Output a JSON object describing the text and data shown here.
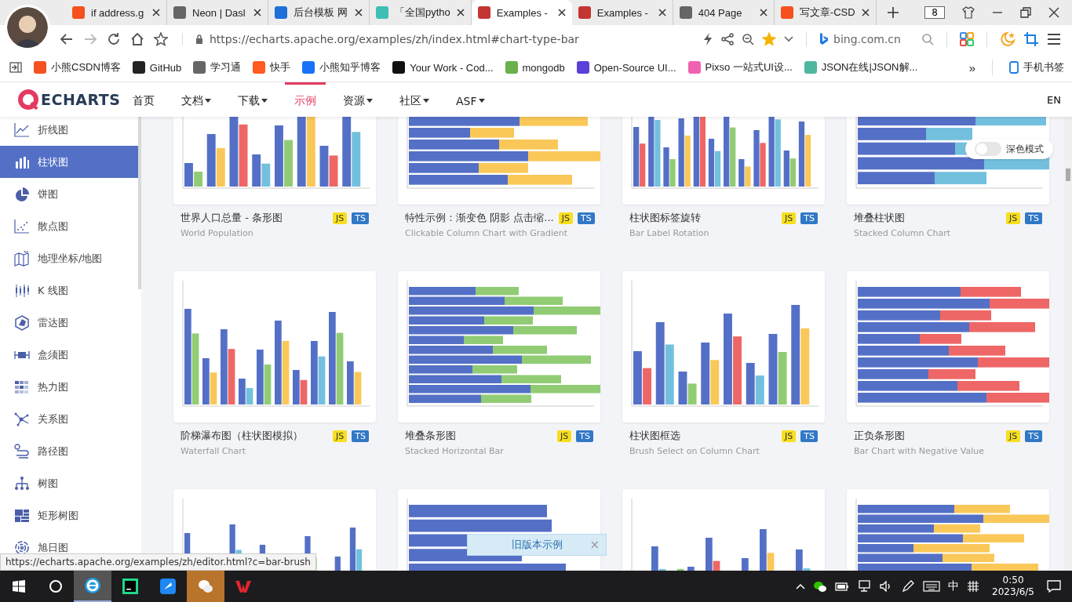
{
  "browser": {
    "tabs": [
      {
        "title": "if address.g",
        "color": "#f4511e",
        "selected": false
      },
      {
        "title": "Neon | Dasl",
        "color": "#666666",
        "selected": false
      },
      {
        "title": "后台模板 网",
        "color": "#1e6fd9",
        "selected": false
      },
      {
        "title": "「全国pytho",
        "color": "#3fbfb4",
        "selected": false
      },
      {
        "title": "Examples -",
        "color": "#c23531",
        "selected": true
      },
      {
        "title": "Examples -",
        "color": "#c23531",
        "selected": false
      },
      {
        "title": "404 Page",
        "color": "#666666",
        "selected": false
      },
      {
        "title": "写文章-CSD",
        "color": "#f4511e",
        "selected": false
      }
    ],
    "tab_count": "8",
    "address": "https://echarts.apache.org/examples/zh/index.html#chart-type-bar",
    "bookmarked": true,
    "search_engine": "bing.com.cn",
    "bookmarks": [
      {
        "label": "小熊CSDN博客",
        "color": "#f4511e"
      },
      {
        "label": "GitHub",
        "color": "#222222"
      },
      {
        "label": "学习通",
        "color": "#666666"
      },
      {
        "label": "快手",
        "color": "#ff5a1f"
      },
      {
        "label": "小熊知乎博客",
        "color": "#1772f6"
      },
      {
        "label": "Your Work - Cod...",
        "color": "#111111"
      },
      {
        "label": "mongodb",
        "color": "#6ab04c"
      },
      {
        "label": "Open-Source UI...",
        "color": "#5b3fd9"
      },
      {
        "label": "Pixso 一站式UI设...",
        "color": "#f062b0"
      },
      {
        "label": "JSON在线|JSON解...",
        "color": "#4fb7a0"
      }
    ],
    "more": "»",
    "mobile_bookmarks": "手机书签"
  },
  "site": {
    "logo": "ECHARTS",
    "nav": [
      {
        "label": "首页",
        "dropdown": false,
        "selected": false
      },
      {
        "label": "文档",
        "dropdown": true,
        "selected": false
      },
      {
        "label": "下载",
        "dropdown": true,
        "selected": false
      },
      {
        "label": "示例",
        "dropdown": false,
        "selected": true
      },
      {
        "label": "资源",
        "dropdown": true,
        "selected": false
      },
      {
        "label": "社区",
        "dropdown": true,
        "selected": false
      },
      {
        "label": "ASF",
        "dropdown": true,
        "selected": false
      }
    ],
    "language": "EN"
  },
  "sidebar": {
    "items": [
      {
        "label": "折线图",
        "kind": "line",
        "selected": false
      },
      {
        "label": "柱状图",
        "kind": "bar",
        "selected": true
      },
      {
        "label": "饼图",
        "kind": "pie",
        "selected": false
      },
      {
        "label": "散点图",
        "kind": "scatter",
        "selected": false
      },
      {
        "label": "地理坐标/地图",
        "kind": "map",
        "selected": false
      },
      {
        "label": "K 线图",
        "kind": "candlestick",
        "selected": false
      },
      {
        "label": "雷达图",
        "kind": "radar",
        "selected": false
      },
      {
        "label": "盒须图",
        "kind": "boxplot",
        "selected": false
      },
      {
        "label": "热力图",
        "kind": "heatmap",
        "selected": false
      },
      {
        "label": "关系图",
        "kind": "graph",
        "selected": false
      },
      {
        "label": "路径图",
        "kind": "lines",
        "selected": false
      },
      {
        "label": "树图",
        "kind": "tree",
        "selected": false
      },
      {
        "label": "矩形树图",
        "kind": "treemap",
        "selected": false
      },
      {
        "label": "旭日图",
        "kind": "sunburst",
        "selected": false
      }
    ]
  },
  "gallery": {
    "cards": [
      {
        "kind": "example",
        "title": "世界人口总量 - 条形图",
        "subtitle": "World Population",
        "badges": [
          "JS",
          "TS"
        ]
      },
      {
        "kind": "example",
        "title": "特性示例：渐变色 阴影 点击缩...",
        "subtitle": "Clickable Column Chart with Gradient",
        "badges": [
          "JS",
          "TS"
        ]
      },
      {
        "kind": "example",
        "title": "柱状图标签旋转",
        "subtitle": "Bar Label Rotation",
        "badges": [
          "JS",
          "TS"
        ]
      },
      {
        "kind": "example",
        "title": "堆叠柱状图",
        "subtitle": "Stacked Column Chart",
        "badges": [
          "JS",
          "TS"
        ]
      },
      {
        "kind": "example",
        "title": "阶梯瀑布图（柱状图模拟）",
        "subtitle": "Waterfall Chart",
        "badges": [
          "JS",
          "TS"
        ]
      },
      {
        "kind": "example",
        "title": "堆叠条形图",
        "subtitle": "Stacked Horizontal Bar",
        "badges": [
          "JS",
          "TS"
        ]
      },
      {
        "kind": "example",
        "title": "柱状图框选",
        "subtitle": "Brush Select on Column Chart",
        "badges": [
          "JS",
          "TS"
        ]
      },
      {
        "kind": "example",
        "title": "正负条形图",
        "subtitle": "Bar Chart with Negative Value",
        "badges": [
          "JS",
          "TS"
        ]
      },
      {
        "kind": "picture"
      },
      {
        "kind": "picture"
      },
      {
        "kind": "picture"
      },
      {
        "kind": "picture"
      }
    ],
    "dark_mode": {
      "label": "深色模式",
      "on": false
    },
    "old_version": {
      "label": "旧版本示例",
      "close": "×"
    }
  },
  "status_url": "https://echarts.apache.org/examples/zh/editor.html?c=bar-brush",
  "taskbar": {
    "ime": "中",
    "time": "0:50",
    "date": "2023/6/5"
  }
}
